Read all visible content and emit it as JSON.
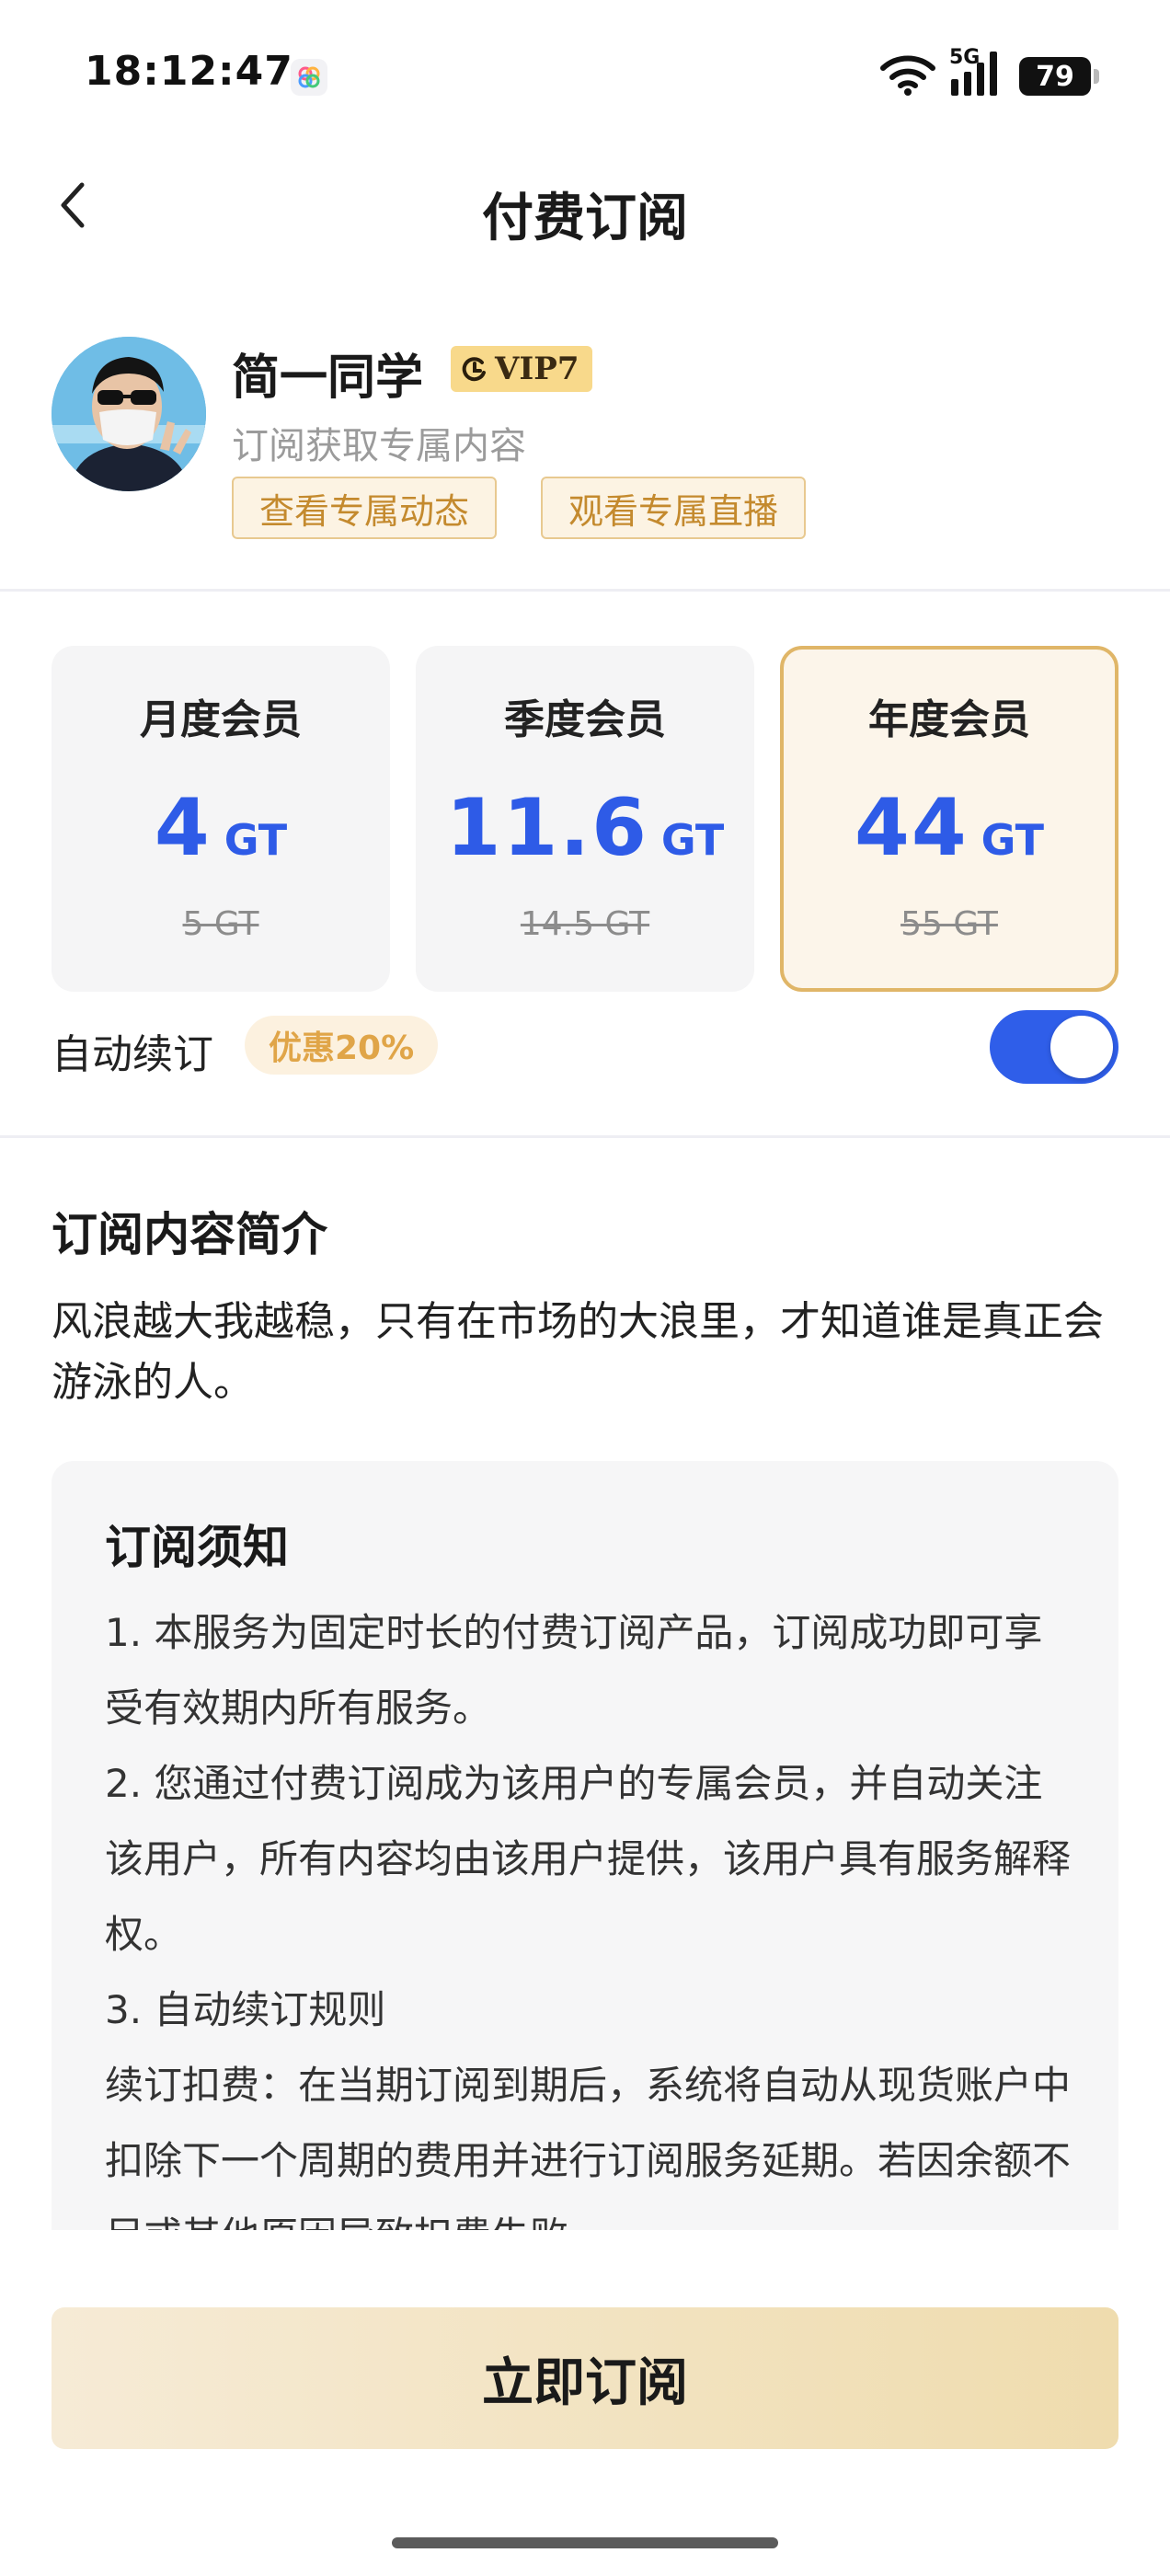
{
  "status_bar": {
    "time": "18:12:47",
    "network": "5G",
    "battery": "79",
    "icons": [
      "app-icon",
      "wifi-icon",
      "signal-icon",
      "battery-icon"
    ]
  },
  "nav": {
    "back_icon": "chevron-left-icon",
    "title": "付费订阅"
  },
  "profile": {
    "name": "简一同学",
    "vip_badge": "VIP7",
    "subtitle": "订阅获取专属内容",
    "tags": [
      "查看专属动态",
      "观看专属直播"
    ]
  },
  "plans": [
    {
      "name": "月度会员",
      "price": "4",
      "unit": "GT",
      "original": "5 GT",
      "selected": false
    },
    {
      "name": "季度会员",
      "price": "11.6",
      "unit": "GT",
      "original": "14.5 GT",
      "selected": false
    },
    {
      "name": "年度会员",
      "price": "44",
      "unit": "GT",
      "original": "55 GT",
      "selected": true
    }
  ],
  "auto_renew": {
    "label": "自动续订",
    "discount": "优惠20%",
    "enabled": true
  },
  "intro": {
    "title": "订阅内容简介",
    "text": "风浪越大我越稳，只有在市场的大浪里，才知道谁是真正会游泳的人。"
  },
  "notice": {
    "title": "订阅须知",
    "lines": [
      "1. 本服务为固定时长的付费订阅产品，订阅成功即可享受有效期内所有服务。",
      "2. 您通过付费订阅成为该用户的专属会员，并自动关注该用户，所有内容均由该用户提供，该用户具有服务解释权。",
      "3. 自动续订规则",
      "续订扣费：在当期订阅到期后，系统将自动从现货账户中扣除下一个周期的费用并进行订阅服务延期。若因余额不足或其他原因导致扣费失败"
    ]
  },
  "subscribe_button": "立即订阅",
  "colors": {
    "accent_blue": "#2e5be7",
    "gold": "#e0b668",
    "toggle_on": "#2f5ee9"
  }
}
